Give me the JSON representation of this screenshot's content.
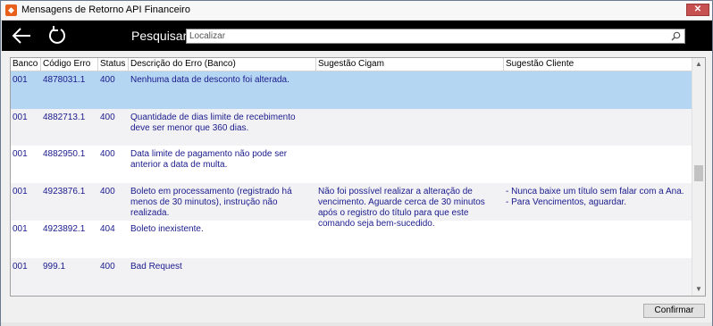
{
  "window": {
    "title": "Mensagens de Retorno API Financeiro",
    "close_glyph": "✕"
  },
  "toolbar": {
    "back_icon": "arrow-left-icon",
    "refresh_icon": "refresh-icon",
    "search_label": "Pesquisar",
    "search_placeholder": "Localizar",
    "search_value": ""
  },
  "table": {
    "columns": [
      "Banco",
      "Código Erro",
      "Status",
      "Descrição do Erro (Banco)",
      "Sugestão Cigam",
      "Sugestão Cliente"
    ],
    "rows": [
      {
        "banco": "001",
        "codigo": "4878031.1",
        "status": "400",
        "descricao": "Nenhuma data de desconto foi alterada.",
        "cigam": "",
        "cliente": "",
        "selected": true
      },
      {
        "banco": "001",
        "codigo": "4882713.1",
        "status": "400",
        "descricao": "Quantidade de dias limite de recebimento deve ser menor que 360 dias.",
        "cigam": "",
        "cliente": ""
      },
      {
        "banco": "001",
        "codigo": "4882950.1",
        "status": "400",
        "descricao": "Data limite de pagamento não pode ser anterior a data de multa.",
        "cigam": "",
        "cliente": ""
      },
      {
        "banco": "001",
        "codigo": "4923876.1",
        "status": "400",
        "descricao": "Boleto em processamento (registrado há menos de 30 minutos), instrução não realizada.",
        "cigam": "Não foi possível realizar a alteração de vencimento. Aguarde cerca de 30 minutos após o registro do título para que este comando seja bem-sucedido.",
        "cliente": "- Nunca baixe um título sem falar com a Ana.\n- Para Vencimentos, aguardar."
      },
      {
        "banco": "001",
        "codigo": "4923892.1",
        "status": "404",
        "descricao": "Boleto inexistente.",
        "cigam": "",
        "cliente": ""
      },
      {
        "banco": "001",
        "codigo": "999.1",
        "status": "400",
        "descricao": "Bad Request",
        "cigam": "",
        "cliente": ""
      }
    ]
  },
  "footer": {
    "confirm_label": "Confirmar"
  }
}
